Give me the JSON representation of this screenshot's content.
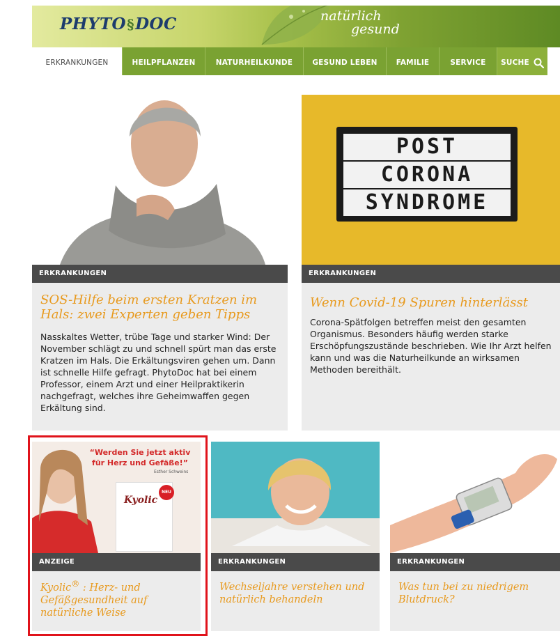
{
  "header": {
    "logo_left": "PHYTO",
    "logo_mark": "§",
    "logo_right": "DOC",
    "slogan_line1": "natürlich",
    "slogan_line2": "gesund"
  },
  "nav": {
    "items": [
      {
        "label": "ERKRANKUNGEN",
        "active": true
      },
      {
        "label": "HEILPFLANZEN"
      },
      {
        "label": "NATURHEILKUNDE"
      },
      {
        "label": "GESUND LEBEN"
      },
      {
        "label": "FAMILIE"
      },
      {
        "label": "SERVICE"
      },
      {
        "label": "SUCHE"
      }
    ]
  },
  "articles": [
    {
      "category": "ERKRANKUNGEN",
      "title": "SOS-Hilfe beim ersten Kratzen im Hals: zwei Experten geben Tipps",
      "text": "Nasskaltes Wetter, trübe Tage und starker Wind: Der November schlägt zu und schnell spürt man das erste Kratzen im Hals. Die Erkältungsviren gehen um. Dann ist schnelle Hilfe gefragt. PhytoDoc hat bei einem Professor, einem Arzt und einer Heilpraktikerin nachgefragt, welches ihre Geheimwaffen gegen Erkältung sind."
    },
    {
      "category": "ERKRANKUNGEN",
      "title": "Wenn Covid-19 Spuren hinterlässt",
      "text": "Corona-Spätfolgen betreffen meist den gesamten Organismus. Besonders häufig werden starke Erschöpfungszustände beschrieben. Wie Ihr Arzt helfen kann und was die Naturheilkunde an wirksamen Methoden bereithält.",
      "image_lines": [
        "POST",
        "CORONA",
        "SYNDROME"
      ]
    },
    {
      "category": "ANZEIGE",
      "title_brand": "Kyolic",
      "title_mark": "®",
      "title_rest": " : Herz- und Gefäßgesundheit auf natürliche Weise",
      "ad_quote": "“Werden Sie jetzt aktiv für Herz und Gefäße!”",
      "ad_author": "Esther Schweins",
      "ad_brand": "Kyolic",
      "ad_badge": "NEU"
    },
    {
      "category": "ERKRANKUNGEN",
      "title": "Wechseljahre verstehen und natürlich behandeln"
    },
    {
      "category": "ERKRANKUNGEN",
      "title": "Was tun bei zu niedrigem Blutdruck?"
    }
  ],
  "colors": {
    "accent_title": "#e89a1e",
    "nav_green": "#7aa232",
    "category_bar": "#4a4a4a",
    "ad_highlight": "#e0131b"
  }
}
